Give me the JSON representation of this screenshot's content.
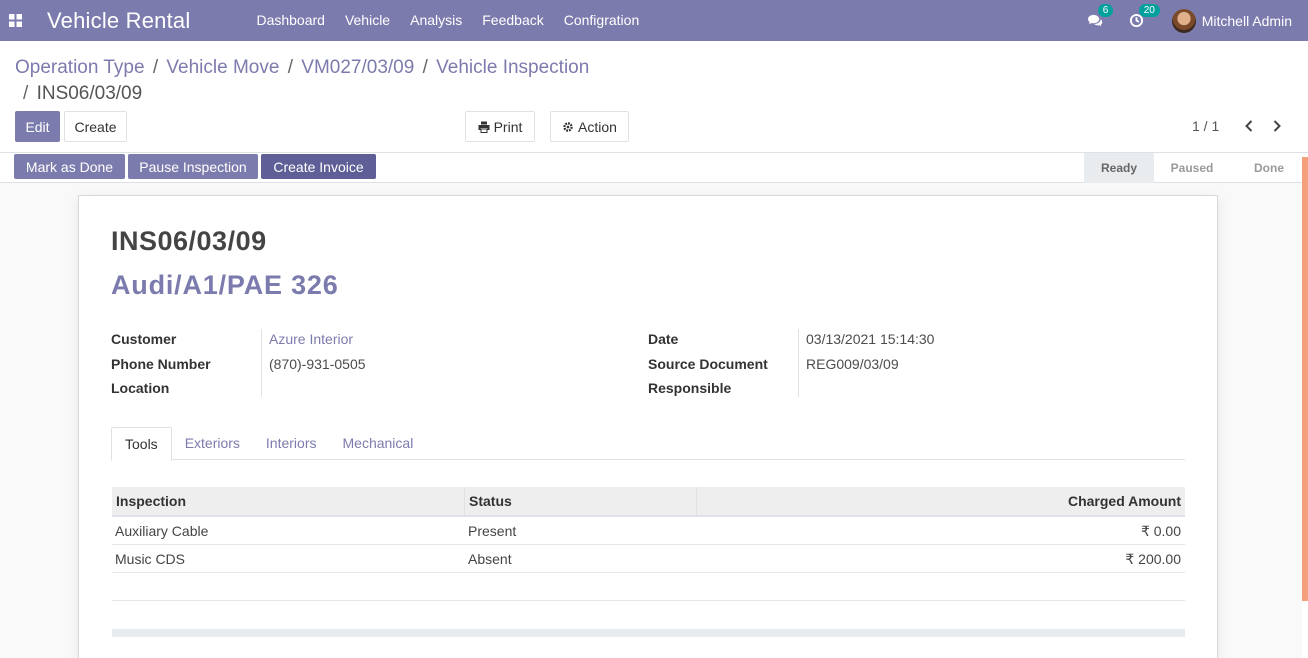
{
  "app": {
    "title": "Vehicle Rental"
  },
  "menu": [
    "Dashboard",
    "Vehicle",
    "Analysis",
    "Feedback",
    "Configration"
  ],
  "systray": {
    "messages_count": "6",
    "activities_count": "20",
    "user_name": "Mitchell Admin"
  },
  "breadcrumb": {
    "items": [
      "Operation Type",
      "Vehicle Move",
      "VM027/03/09",
      "Vehicle Inspection"
    ],
    "current": "INS06/03/09",
    "separator": "/"
  },
  "buttons": {
    "edit": "Edit",
    "create": "Create",
    "print": "Print",
    "action": "Action"
  },
  "pager": {
    "value": "1 / 1"
  },
  "statusbar": {
    "buttons": [
      "Mark as Done",
      "Pause Inspection",
      "Create Invoice"
    ],
    "stages": [
      "Ready",
      "Paused",
      "Done"
    ],
    "active_stage": "Ready"
  },
  "record": {
    "name": "INS06/03/09",
    "vehicle": "Audi/A1/PAE 326",
    "left_fields": [
      {
        "label": "Customer",
        "value": "Azure Interior"
      },
      {
        "label": "Phone Number",
        "value": "(870)-931-0505"
      },
      {
        "label": "Location",
        "value": ""
      }
    ],
    "right_fields": [
      {
        "label": "Date",
        "value": "03/13/2021 15:14:30"
      },
      {
        "label": "Source Document",
        "value": "REG009/03/09"
      },
      {
        "label": "Responsible",
        "value": ""
      }
    ]
  },
  "tabs": [
    "Tools",
    "Exteriors",
    "Interiors",
    "Mechanical"
  ],
  "active_tab": "Tools",
  "table": {
    "columns": [
      "Inspection",
      "Status",
      "Charged Amount"
    ],
    "rows": [
      [
        "Auxiliary Cable",
        "Present",
        "₹ 0.00"
      ],
      [
        "Music CDS",
        "Absent",
        "₹ 200.00"
      ]
    ]
  },
  "colors": {
    "brand": "#7c7bad",
    "badge": "#00a09d",
    "scroll_accent": "#f4a07a"
  }
}
